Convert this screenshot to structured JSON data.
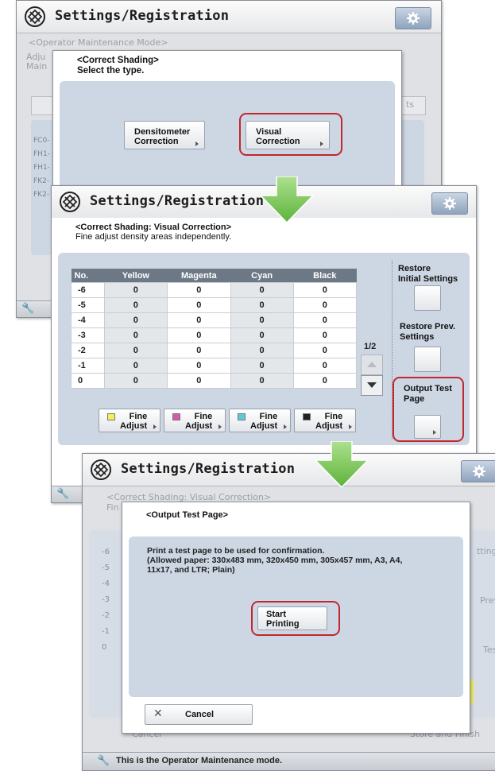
{
  "window_title": "Settings/Registration",
  "operator_mode_label": "<Operator Maintenance Mode>",
  "screen1": {
    "dialog_title": "<Correct Shading>",
    "dialog_subtitle": "Select the type.",
    "densitometer_label": "Densitometer\nCorrection",
    "visual_label": "Visual\nCorrection",
    "bg_text_adju": "Adju",
    "bg_text_main": "Main",
    "bg_list": [
      "FC0-",
      "FH1-",
      "FH1-",
      "FK2-",
      "FK2-"
    ],
    "bg_right_ts": "ts"
  },
  "screen2": {
    "header_line1": "<Correct Shading: Visual Correction>",
    "header_line2": "Fine adjust density areas independently.",
    "columns": [
      "No.",
      "Yellow",
      "Magenta",
      "Cyan",
      "Black"
    ],
    "rows": [
      [
        "-6",
        "0",
        "0",
        "0",
        "0"
      ],
      [
        "-5",
        "0",
        "0",
        "0",
        "0"
      ],
      [
        "-4",
        "0",
        "0",
        "0",
        "0"
      ],
      [
        "-3",
        "0",
        "0",
        "0",
        "0"
      ],
      [
        "-2",
        "0",
        "0",
        "0",
        "0"
      ],
      [
        "-1",
        "0",
        "0",
        "0",
        "0"
      ],
      [
        "0",
        "0",
        "0",
        "0",
        "0"
      ]
    ],
    "page_indicator": "1/2",
    "restore_initial": "Restore\nInitial Settings",
    "restore_prev": "Restore Prev.\nSettings",
    "output_test_page": "Output Test\nPage",
    "fine_adjust": [
      {
        "label": "Fine\nAdjust",
        "color": "#f2ee5c"
      },
      {
        "label": "Fine\nAdjust",
        "color": "#d45aa8"
      },
      {
        "label": "Fine\nAdjust",
        "color": "#5ec8dc"
      },
      {
        "label": "Fine\nAdjust",
        "color": "#222222"
      }
    ]
  },
  "screen3": {
    "bg_header_line1": "<Correct Shading: Visual Correction>",
    "bg_header_line2": "Fin",
    "dialog_title": "<Output Test Page>",
    "message": "Print a test page to be used for confirmation.\n(Allowed paper: 330x483 mm, 320x450 mm, 305x457 mm, A3, A4,\n11x17, and LTR; Plain)",
    "start_printing": "Start\nPrinting",
    "cancel": "Cancel",
    "bg_right_1": "ttings",
    "bg_right_2": "Prev.",
    "bg_right_3": "Test",
    "bg_cancel": "Cancel",
    "bg_store": "Store and Finish",
    "bg_rows": [
      "-6",
      "-5",
      "-4",
      "-3",
      "-2",
      "-1",
      "0"
    ],
    "status_text": "This is the Operator Maintenance mode."
  },
  "colors": {
    "highlight": "#c1272d",
    "arrow": "#6cc24a",
    "table_header": "#6d7886",
    "panel": "#cdd6e3"
  }
}
